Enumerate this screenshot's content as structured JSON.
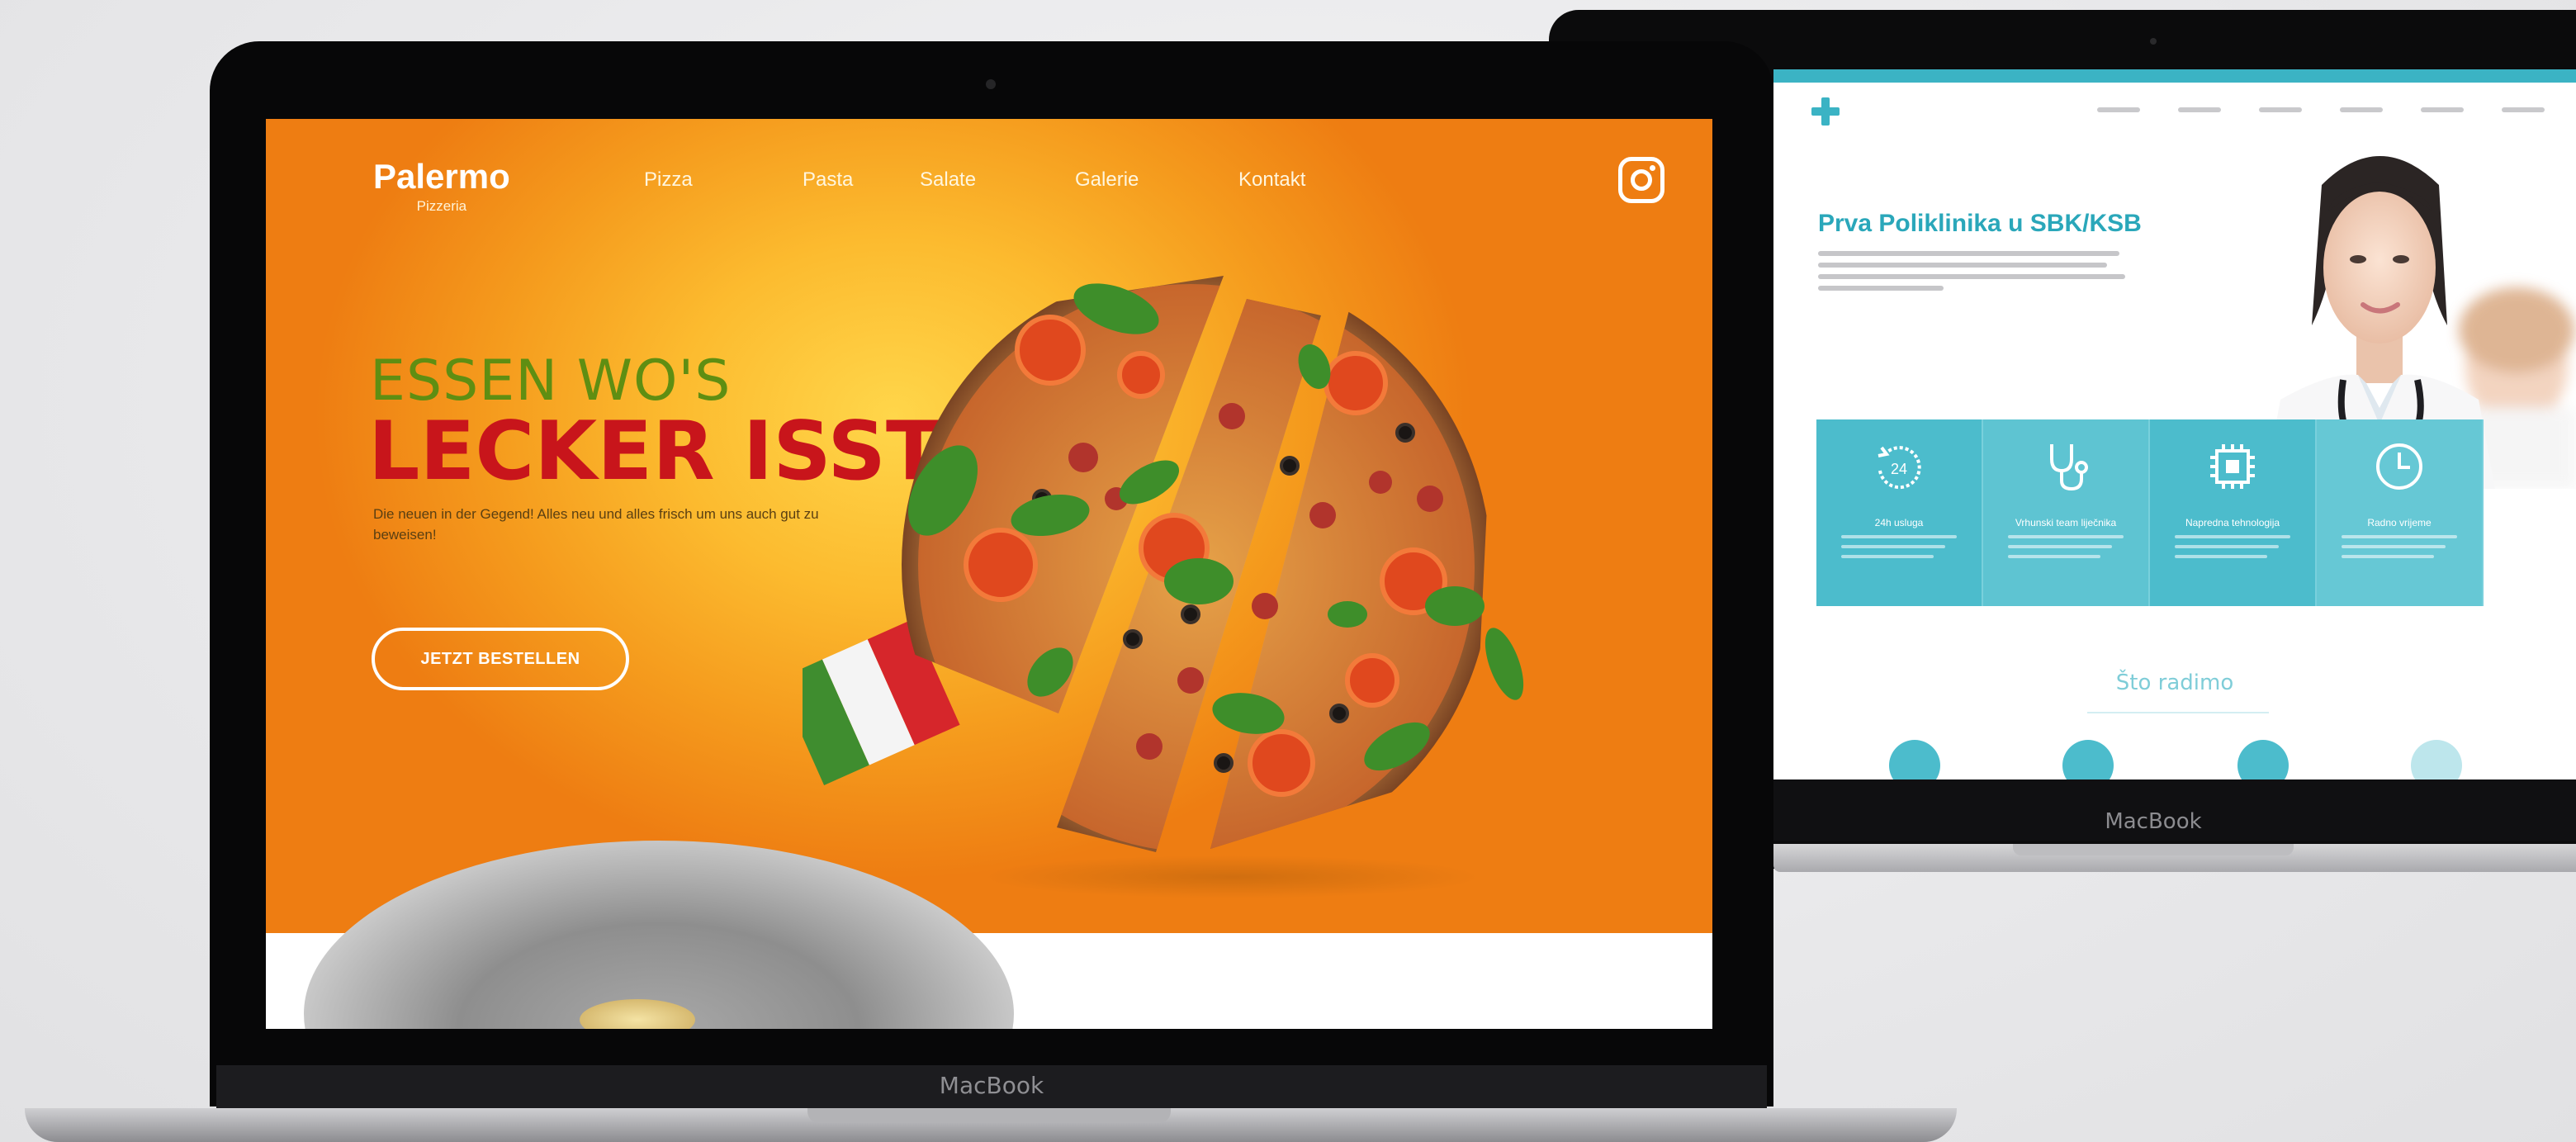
{
  "front_laptop": {
    "brand_label": "MacBook",
    "site": {
      "logo": {
        "name": "Palermo",
        "subtitle": "Pizzeria"
      },
      "nav": [
        {
          "label": "Pizza"
        },
        {
          "label": "Pasta"
        },
        {
          "label": "Salate"
        },
        {
          "label": "Galerie"
        },
        {
          "label": "Kontakt"
        }
      ],
      "social_icon": "instagram-icon",
      "hero": {
        "headline_line1": "ESSEN WO'S",
        "headline_line2": "LECKER ISST!",
        "subtext": "Die neuen in der Gegend! Alles neu und alles frisch um uns auch gut zu beweisen!",
        "cta_label": "JETZT BESTELLEN"
      }
    },
    "colors": {
      "orange": "#f28f1c",
      "headline_green": "#5f8e12",
      "headline_red": "#c8151b"
    }
  },
  "back_laptop": {
    "brand_label": "MacBook",
    "site": {
      "title": "Prva Poliklinika u SBK/KSB",
      "services": [
        {
          "label": "24h usluga",
          "icon": "clock-24-icon"
        },
        {
          "label": "Vrhunski team liječnika",
          "icon": "stethoscope-icon"
        },
        {
          "label": "Napredna tehnologija",
          "icon": "chip-icon"
        },
        {
          "label": "Radno vrijeme",
          "icon": "clock-icon"
        }
      ],
      "section_title": "Što radimo"
    },
    "colors": {
      "teal": "#3bb3c4"
    }
  }
}
